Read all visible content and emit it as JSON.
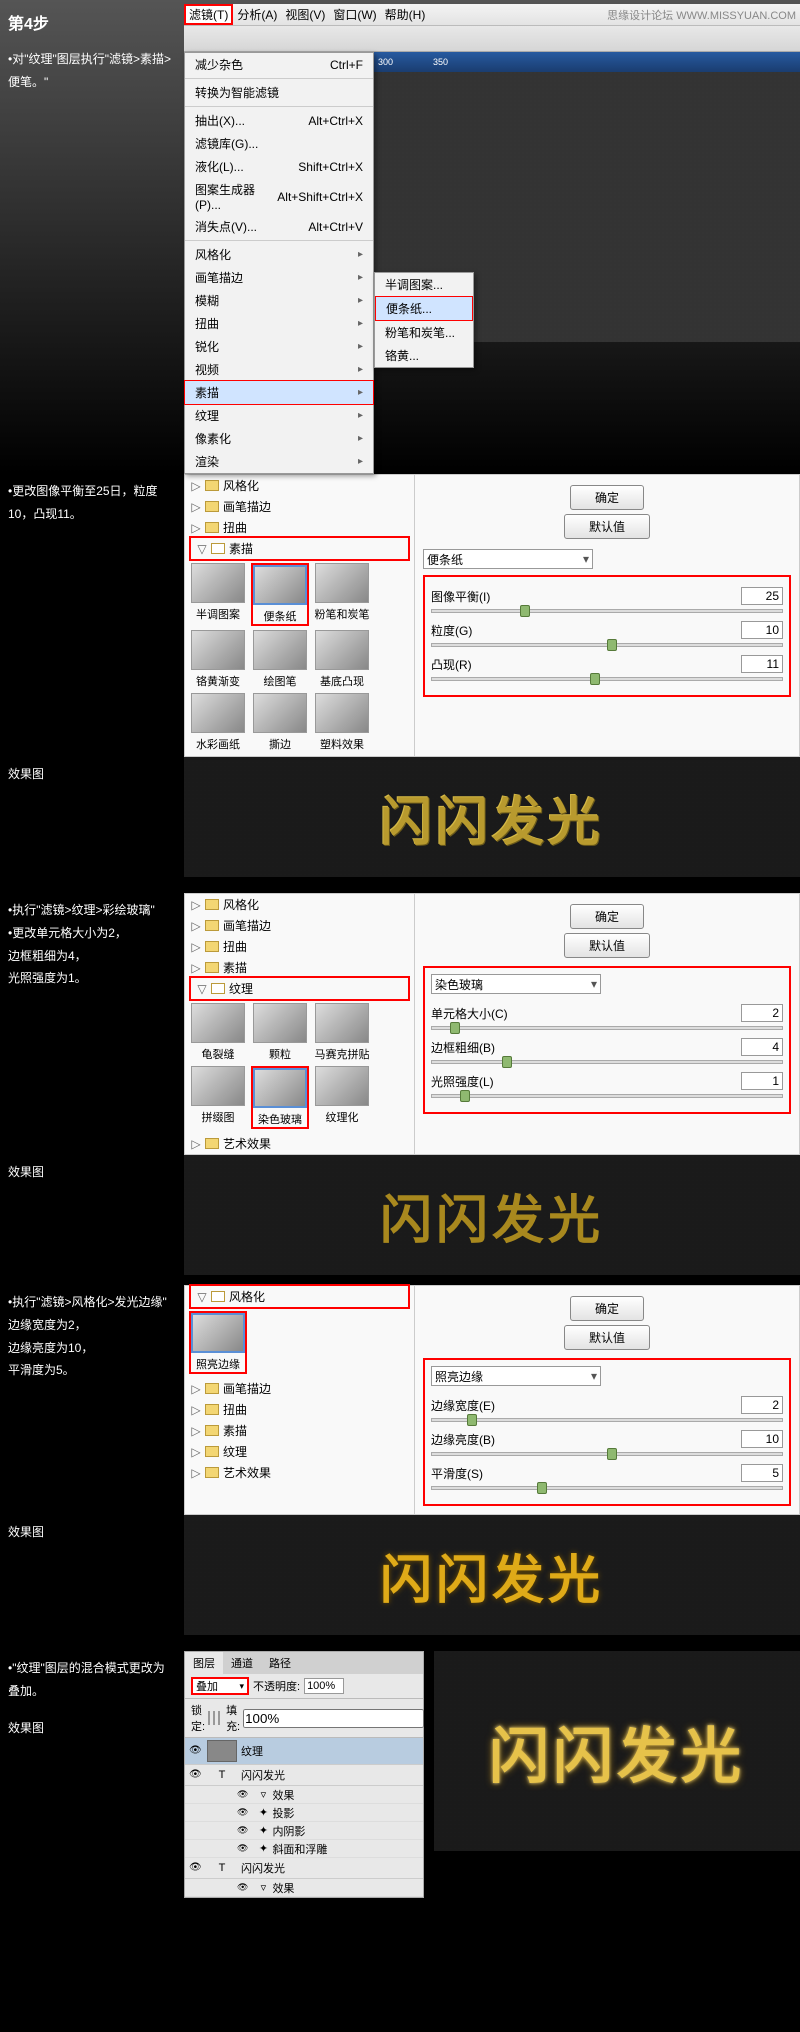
{
  "watermark": "思缘设计论坛  WWW.MISSYUAN.COM",
  "step": {
    "title": "第4步",
    "p1": "对\"纹理\"图层执行\"滤镜>素描>便笔。\""
  },
  "menubar": {
    "filter": "滤镜(T)",
    "analysis": "分析(A)",
    "view": "视图(V)",
    "window": "窗口(W)",
    "help": "帮助(H)"
  },
  "filterMenu": {
    "reduceNoise": "减少杂色",
    "reduceNoiseKey": "Ctrl+F",
    "smartFilter": "转换为智能滤镜",
    "extract": "抽出(X)...",
    "extractKey": "Alt+Ctrl+X",
    "filterGallery": "滤镜库(G)...",
    "liquify": "液化(L)...",
    "liquifyKey": "Shift+Ctrl+X",
    "patternMaker": "图案生成器(P)...",
    "patternKey": "Alt+Shift+Ctrl+X",
    "vanishing": "消失点(V)...",
    "vanishingKey": "Alt+Ctrl+V",
    "stylize": "风格化",
    "brushStrokes": "画笔描边",
    "blur": "模糊",
    "distort": "扭曲",
    "sharpen": "锐化",
    "video": "视频",
    "sketch": "素描",
    "texture": "纹理",
    "pixelate": "像素化",
    "render": "渲染"
  },
  "sketchSub": {
    "halftone": "半调图案...",
    "notepaper": "便条纸...",
    "chalk": "粉笔和炭笔...",
    "chrome": "铬黄..."
  },
  "step2": {
    "text": "更改图像平衡至25日，粒度10，凸现11。"
  },
  "gallery": {
    "folders": {
      "stylize": "风格化",
      "brushStrokes": "画笔描边",
      "distort": "扭曲",
      "sketch": "素描",
      "texture": "纹理",
      "artistic": "艺术效果"
    },
    "sketchThumbs": {
      "halftone": "半调图案",
      "notepaper": "便条纸",
      "chalk": "粉笔和炭笔",
      "chrome": "铬黄渐变",
      "graphic": "绘图笔",
      "basrelief": "基底凸现",
      "water": "水彩画纸",
      "torn": "撕边",
      "plastic": "塑料效果"
    },
    "textureThumbs": {
      "craquelure": "龟裂缝",
      "grain": "颗粒",
      "mosaic": "马赛克拼贴",
      "patchwork": "拼缀图",
      "stained": "染色玻璃",
      "texturizer": "纹理化"
    },
    "stylizeThumbs": {
      "glowing": "照亮边缘"
    },
    "ok": "确定",
    "default": "默认值"
  },
  "params1": {
    "dd": "便条纸",
    "balance": "图像平衡(I)",
    "balanceV": "25",
    "grain": "粒度(G)",
    "grainV": "10",
    "relief": "凸现(R)",
    "reliefV": "11"
  },
  "effect": {
    "label": "效果图",
    "text": "闪闪发光"
  },
  "step3": {
    "l1": "执行\"滤镜>纹理>彩绘玻璃\"",
    "l2": "更改单元格大小为2，",
    "l3": "边框粗细为4，",
    "l4": "光照强度为1。"
  },
  "params2": {
    "dd": "染色玻璃",
    "cell": "单元格大小(C)",
    "cellV": "2",
    "border": "边框粗细(B)",
    "borderV": "4",
    "light": "光照强度(L)",
    "lightV": "1"
  },
  "step4": {
    "l1": "执行\"滤镜>风格化>发光边缘\"",
    "l2": "边缘宽度为2，",
    "l3": "边缘亮度为10，",
    "l4": "平滑度为5。"
  },
  "params3": {
    "dd": "照亮边缘",
    "width": "边缘宽度(E)",
    "widthV": "2",
    "bright": "边缘亮度(B)",
    "brightV": "10",
    "smooth": "平滑度(S)",
    "smoothV": "5"
  },
  "step5": {
    "l1": "\"纹理\"图层的混合模式更改为叠加。"
  },
  "layers": {
    "tabs": {
      "layers": "图层",
      "channels": "通道",
      "paths": "路径"
    },
    "blend": "叠加",
    "opacity": "不透明度:",
    "opacityV": "100%",
    "lock": "锁定:",
    "fill": "填充:",
    "fillV": "100%",
    "texture": "纹理",
    "text": "闪闪发光",
    "effects": "效果",
    "shadow": "投影",
    "innerShadow": "内阴影",
    "bevel": "斜面和浮雕",
    "text2": "闪闪发光"
  }
}
